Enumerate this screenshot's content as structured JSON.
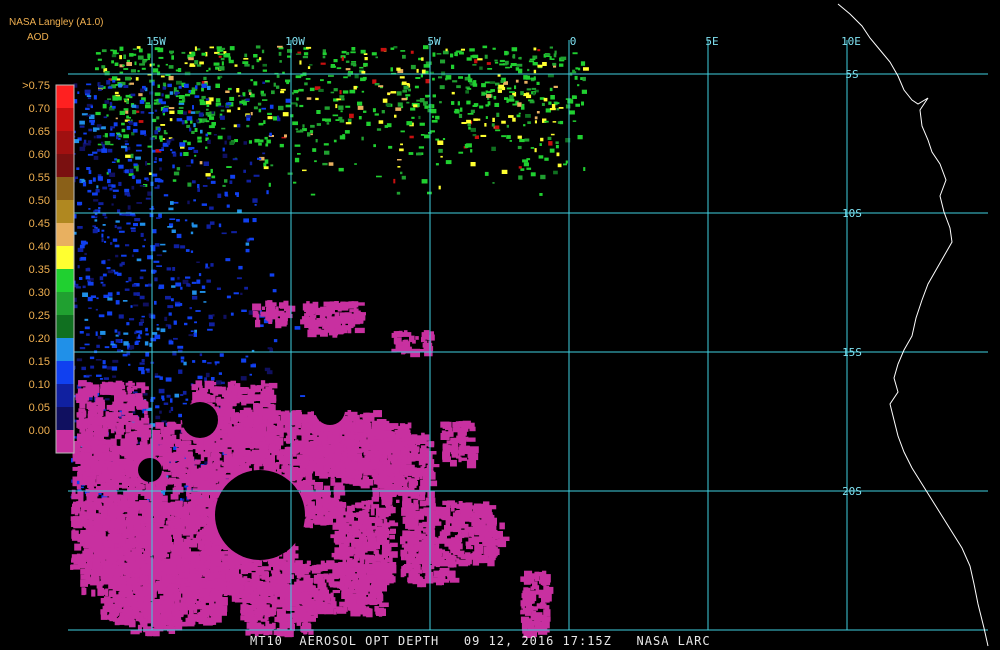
{
  "header": {
    "source": "NASA Langley (A1.0)",
    "product": "AOD"
  },
  "legend": {
    "labels": [
      ">0.75",
      "0.70",
      "0.65",
      "0.60",
      "0.55",
      "0.50",
      "0.45",
      "0.40",
      "0.35",
      "0.30",
      "0.25",
      "0.20",
      "0.15",
      "0.10",
      "0.05",
      "0.00"
    ],
    "colors": [
      "#ff2020",
      "#c81010",
      "#a01010",
      "#7a1010",
      "#8a6018",
      "#b08820",
      "#e8b060",
      "#ffff30",
      "#20d030",
      "#20a030",
      "#107020",
      "#2090e8",
      "#1040f0",
      "#1020a0",
      "#101060",
      "#c830a0"
    ]
  },
  "map": {
    "lon_labels": [
      "15W",
      "10W",
      "5W",
      "0",
      "5E",
      "10E"
    ],
    "lat_labels": [
      "5S",
      "10S",
      "15S",
      "20S"
    ],
    "grid_color": "#40d0e0",
    "coast_color": "#ffffff"
  },
  "footer": {
    "text": "MT10  AEROSOL OPT DEPTH   09 12, 2016 17:15Z   NASA LARC"
  }
}
